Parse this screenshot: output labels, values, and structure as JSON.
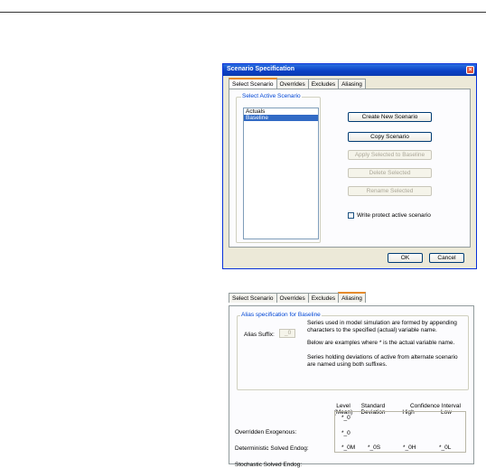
{
  "dialog": {
    "title": "Scenario Specification",
    "close_glyph": "×",
    "tabs": [
      "Select Scenario",
      "Overrides",
      "Excludes",
      "Aliasing"
    ],
    "group_label": "Select Active Scenario",
    "scenarios": [
      "Actuals",
      "Baseline"
    ],
    "selected_scenario": "Baseline",
    "buttons": {
      "create": "Create New Scenario",
      "copy": "Copy Scenario",
      "apply": "Apply Selected to Baseline",
      "delete": "Delete Selected",
      "rename": "Rename  Selected"
    },
    "write_protect_label": "Write protect active scenario",
    "write_protect_checked": false,
    "ok_label": "OK",
    "cancel_label": "Cancel"
  },
  "aliasing_panel": {
    "tabs": [
      "Select Scenario",
      "Overrides",
      "Excludes",
      "Aliasing"
    ],
    "group_label": "Alias specification for Baseline",
    "alias_suffix_label": "Alias Suffix:",
    "alias_suffix_value": "_0",
    "text1": "Series used in model simulation are formed by appending characters to the specified (actual) variable name.",
    "text2": "Below are examples where  *  is the actual variable name.",
    "text3": "Series holding deviations of active from alternate scenario are named using both suffixes.",
    "headers": {
      "level_1": "Level",
      "level_2": "(Mean)",
      "std_1": "Standard",
      "std_2": "Deviation",
      "conf_1": "Confidence Interval",
      "high": "High",
      "low": "Low"
    },
    "rows": [
      {
        "label": "Overridden Exogenous:",
        "level": "*_0",
        "std": "",
        "high": "",
        "low": ""
      },
      {
        "label": "Deterministic Solved Endog:",
        "level": "*_0",
        "std": "",
        "high": "",
        "low": ""
      },
      {
        "label": "Stochastic Solved Endog:",
        "level": "*_0M",
        "std": "*_0S",
        "high": "*_0H",
        "low": "*_0L"
      }
    ]
  },
  "colors": {
    "titlebar": "#0a3fc4",
    "tab_highlight": "#e68b2c",
    "group_label": "#0046d5",
    "selection": "#316ac5"
  }
}
